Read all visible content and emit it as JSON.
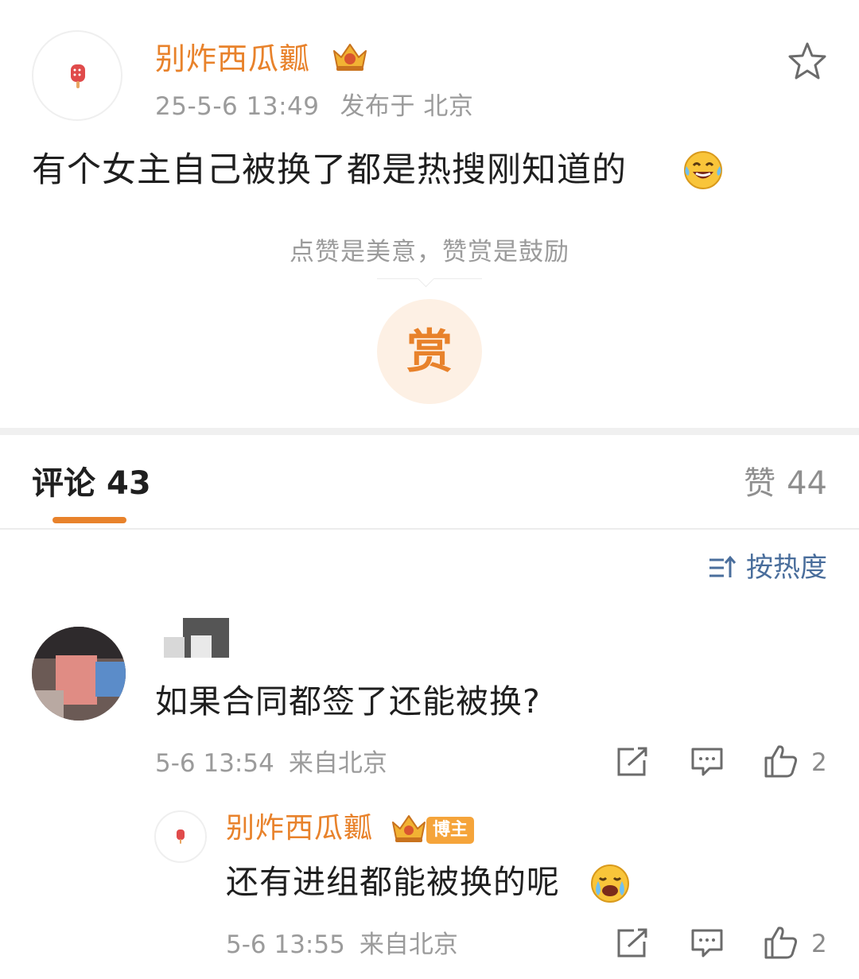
{
  "post": {
    "author": "别炸西瓜瓤",
    "date": "25-5-6 13:49",
    "location": "发布于 北京",
    "text": "有个女主自己被换了都是热搜刚知道的",
    "emoji": "laughing-tears-emoji"
  },
  "reward": {
    "hint": "点赞是美意，赞赏是鼓励",
    "button_label": "赏"
  },
  "tabs": {
    "comments_label": "评论",
    "comments_count": "43",
    "likes_label": "赞",
    "likes_count": "44"
  },
  "sort": {
    "label": "按热度",
    "icon": "sort-icon"
  },
  "comments": [
    {
      "text": "如果合同都签了还能被换?",
      "date": "5-6 13:54",
      "location": "来自北京",
      "likes": "2",
      "replies": [
        {
          "author": "别炸西瓜瓤",
          "badge": "博主",
          "text": "还有进组都能被换的呢",
          "emoji": "crying-emoji",
          "date": "5-6 13:55",
          "location": "来自北京",
          "likes": "2"
        }
      ]
    }
  ],
  "colors": {
    "brand_orange": "#e8822b",
    "link_blue": "#4a6e9c",
    "muted_gray": "#9b9b9b",
    "badge_orange": "#f5a43a"
  }
}
